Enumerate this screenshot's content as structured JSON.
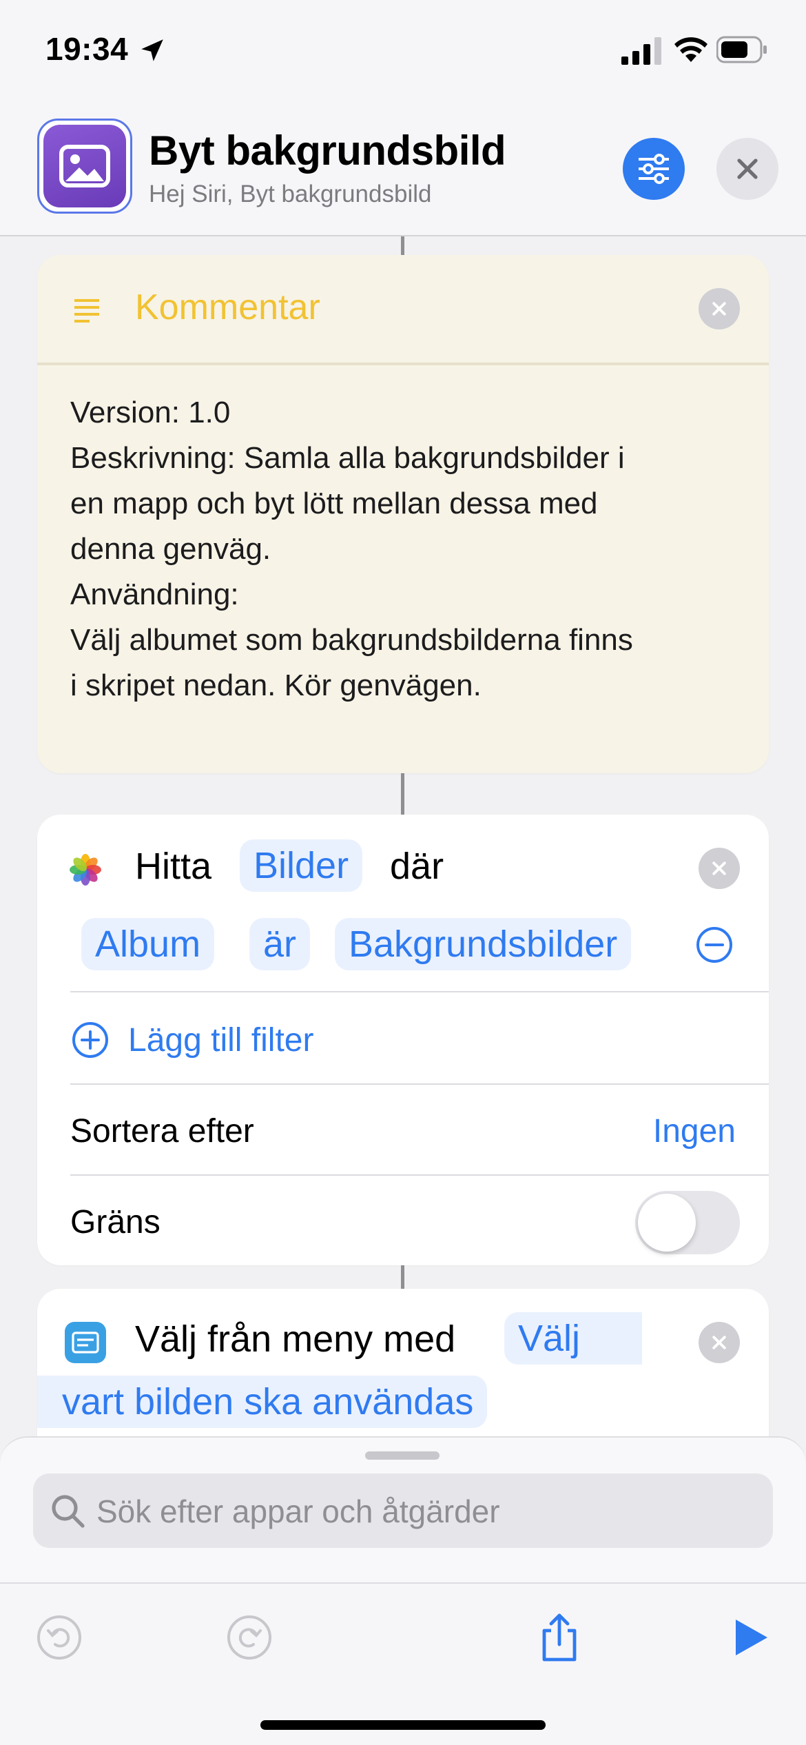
{
  "status_bar": {
    "time": "19:34"
  },
  "header": {
    "title": "Byt bakgrundsbild",
    "subtitle": "Hej Siri, Byt bakgrundsbild"
  },
  "comment": {
    "title": "Kommentar",
    "lines": [
      "Version: 1.0",
      "Beskrivning: Samla alla bakgrundsbilder i",
      "en mapp och byt lött mellan dessa med",
      "denna genväg.",
      "Användning:",
      "Välj albumet som bakgrundsbilderna finns",
      "i skripet nedan. Kör genvägen."
    ]
  },
  "find_action": {
    "verb": "Hitta",
    "target": "Bilder",
    "where": "där",
    "filter_field": "Album",
    "filter_operator": "är",
    "filter_value": "Bakgrundsbilder",
    "add_filter": "Lägg till filter",
    "sort_label": "Sortera efter",
    "sort_value": "Ingen",
    "limit_label": "Gräns",
    "limit_enabled": false
  },
  "menu_action": {
    "label": "Välj från meny med",
    "prompt_part1": "Välj",
    "prompt_part2": "vart bilden ska användas"
  },
  "search": {
    "placeholder": "Sök efter appar och åtgärder"
  },
  "colors": {
    "accent": "#2f7bf0",
    "comment_title": "#f1c232",
    "comment_bg": "#f7f3e6",
    "app_icon": "#7a4ac8"
  },
  "icons": [
    "location-arrow-icon",
    "signal-icon",
    "wifi-icon",
    "battery-icon",
    "photo-icon",
    "sliders-icon",
    "close-icon",
    "text-lines-icon",
    "photos-app-icon",
    "minus-circle-icon",
    "plus-circle-icon",
    "menu-list-icon",
    "search-icon",
    "undo-icon",
    "redo-icon",
    "share-icon",
    "play-icon"
  ]
}
